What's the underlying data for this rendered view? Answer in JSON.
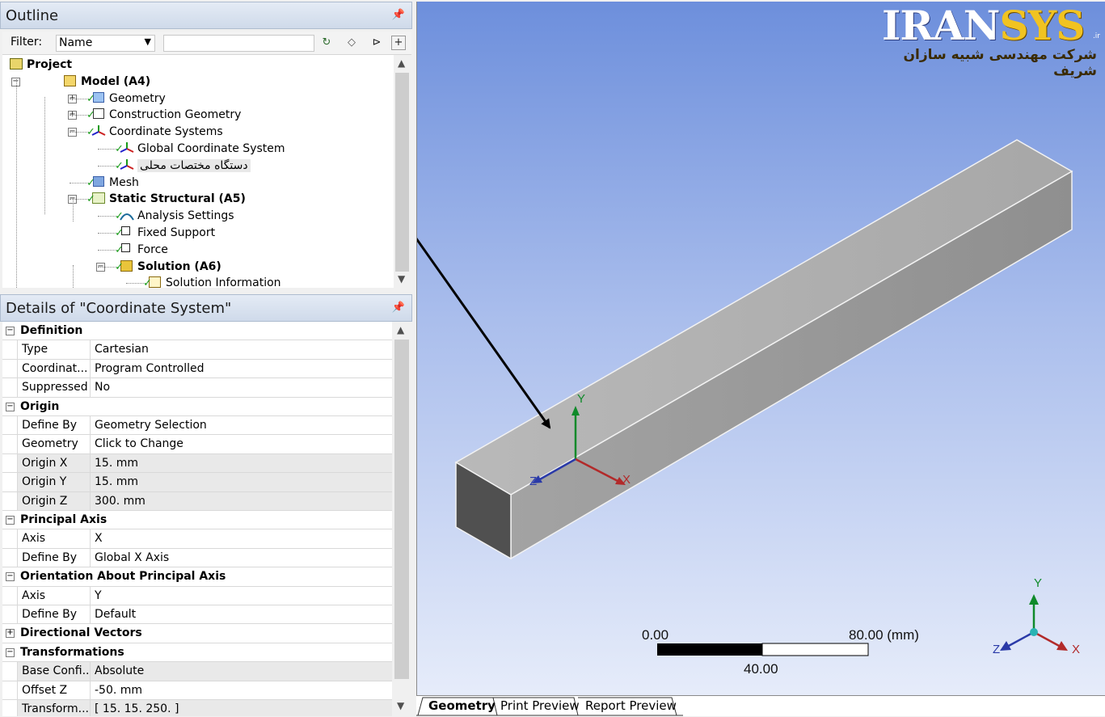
{
  "outline": {
    "title": "Outline",
    "pin": "⚐",
    "filter_label": "Filter:",
    "filter_value": "Name",
    "filter_text": "",
    "tree": [
      {
        "label": "Project",
        "bold": true,
        "level": 0,
        "icon": "project-icon"
      },
      {
        "label": "Model (A4)",
        "bold": true,
        "level": 1,
        "icon": "model-icon",
        "expander": "minus"
      },
      {
        "label": "Geometry",
        "bold": false,
        "level": 2,
        "icon": "geometry-icon",
        "expander": "plus"
      },
      {
        "label": "Construction Geometry",
        "bold": false,
        "level": 2,
        "icon": "construction-geometry-icon",
        "expander": "plus"
      },
      {
        "label": "Coordinate Systems",
        "bold": false,
        "level": 2,
        "icon": "coordinate-systems-icon",
        "expander": "minus"
      },
      {
        "label": "Global Coordinate System",
        "bold": false,
        "level": 3,
        "icon": "coordinate-system-icon"
      },
      {
        "label": "دستگاه مختصات محلی",
        "bold": false,
        "level": 3,
        "icon": "coordinate-system-icon",
        "selected": true
      },
      {
        "label": "Mesh",
        "bold": false,
        "level": 2,
        "icon": "mesh-icon"
      },
      {
        "label": "Static Structural (A5)",
        "bold": true,
        "level": 2,
        "icon": "static-structural-icon",
        "expander": "minus"
      },
      {
        "label": "Analysis Settings",
        "bold": false,
        "level": 3,
        "icon": "analysis-settings-icon"
      },
      {
        "label": "Fixed Support",
        "bold": false,
        "level": 3,
        "icon": "fixed-support-icon"
      },
      {
        "label": "Force",
        "bold": false,
        "level": 3,
        "icon": "force-icon"
      },
      {
        "label": "Solution (A6)",
        "bold": true,
        "level": 3,
        "icon": "solution-icon",
        "expander": "minus"
      },
      {
        "label": "Solution Information",
        "bold": false,
        "level": 4,
        "icon": "solution-information-icon"
      }
    ]
  },
  "details": {
    "title": "Details of \"Coordinate System\"",
    "rows": [
      {
        "type": "cat",
        "label": "Definition",
        "toggle": "−"
      },
      {
        "type": "prop",
        "key": "Type",
        "value": "Cartesian",
        "shade": false
      },
      {
        "type": "prop",
        "key": "Coordinat...",
        "value": "Program Controlled",
        "shade": false
      },
      {
        "type": "prop",
        "key": "Suppressed",
        "value": "No",
        "shade": false
      },
      {
        "type": "cat",
        "label": "Origin",
        "toggle": "−"
      },
      {
        "type": "prop",
        "key": "Define By",
        "value": "Geometry Selection",
        "shade": false
      },
      {
        "type": "prop",
        "key": "Geometry",
        "value": "Click to Change",
        "shade": false
      },
      {
        "type": "prop",
        "key": "Origin X",
        "value": "15. mm",
        "shade": true
      },
      {
        "type": "prop",
        "key": "Origin Y",
        "value": "15. mm",
        "shade": true
      },
      {
        "type": "prop",
        "key": "Origin Z",
        "value": "300. mm",
        "shade": true
      },
      {
        "type": "cat",
        "label": "Principal Axis",
        "toggle": "−"
      },
      {
        "type": "prop",
        "key": "Axis",
        "value": "X",
        "shade": false
      },
      {
        "type": "prop",
        "key": "Define By",
        "value": "Global X Axis",
        "shade": false
      },
      {
        "type": "cat",
        "label": "Orientation About Principal Axis",
        "toggle": "−"
      },
      {
        "type": "prop",
        "key": "Axis",
        "value": "Y",
        "shade": false
      },
      {
        "type": "prop",
        "key": "Define By",
        "value": "Default",
        "shade": false
      },
      {
        "type": "cat",
        "label": "Directional Vectors",
        "toggle": "+"
      },
      {
        "type": "cat",
        "label": "Transformations",
        "toggle": "−"
      },
      {
        "type": "prop",
        "key": "Base Confi...",
        "value": "Absolute",
        "shade": true
      },
      {
        "type": "prop",
        "key": "Offset Z",
        "value": "-50. mm",
        "shade": false
      },
      {
        "type": "prop",
        "key": "Transform...",
        "value": "[ 15. 15. 250. ]",
        "shade": true
      }
    ]
  },
  "viewport": {
    "logo_brand_a": "IRAN",
    "logo_brand_b": "SYS",
    "logo_dot": ".ir",
    "logo_subtitle": "شرکت مهندسی شبیه سازان شریف",
    "local_axes": {
      "x": "X",
      "y": "Y",
      "z": "Z"
    },
    "triad": {
      "x": "X",
      "y": "Y",
      "z": "Z"
    },
    "scale": {
      "min": "0.00",
      "max": "80.00 (mm)",
      "mid": "40.00"
    },
    "colors": {
      "x_axis": "#b22a2a",
      "y_axis": "#0f8a2a",
      "z_axis": "#2a3aa8"
    }
  },
  "tabs": [
    "Geometry",
    "Print Preview",
    "Report Preview"
  ]
}
